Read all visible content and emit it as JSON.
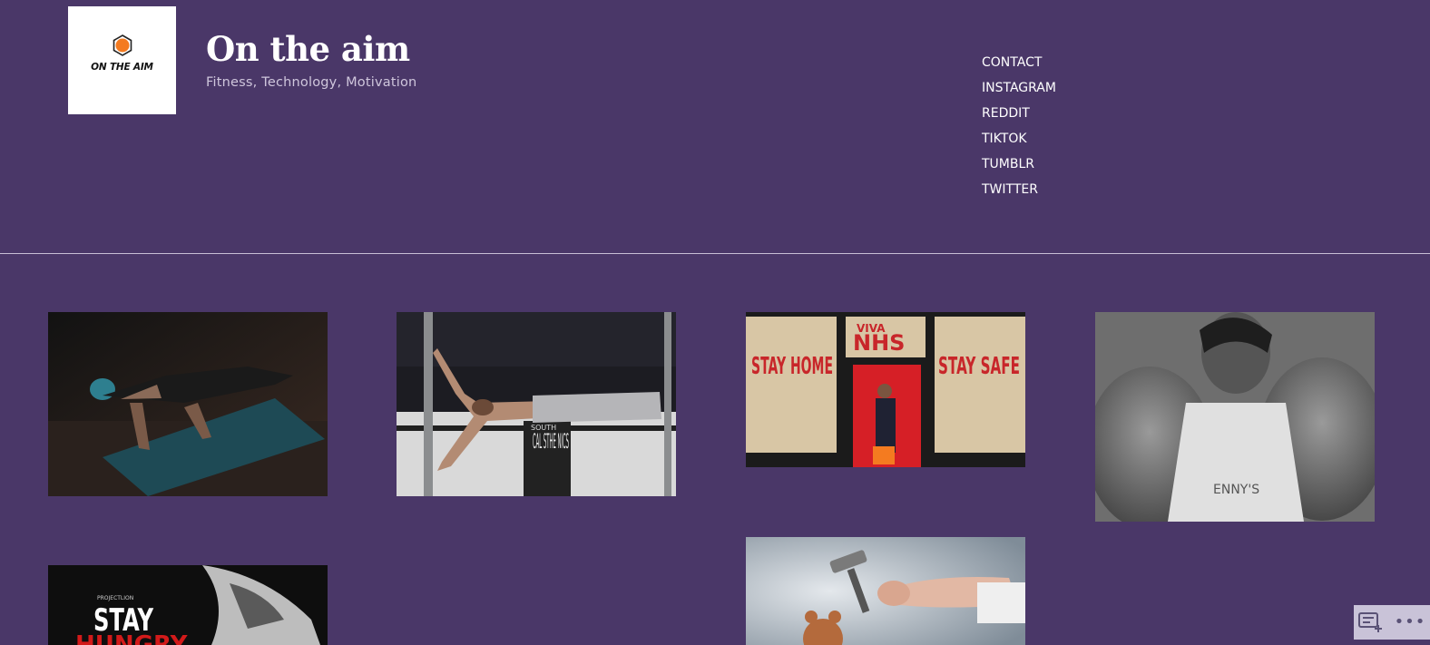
{
  "site": {
    "logo_text": "ON THE AIM",
    "title": "On the aim",
    "tagline": "Fitness, Technology, Motivation"
  },
  "nav": {
    "items": [
      {
        "label": "CONTACT"
      },
      {
        "label": "INSTAGRAM"
      },
      {
        "label": "REDDIT"
      },
      {
        "label": "TIKTOK"
      },
      {
        "label": "TUMBLR"
      },
      {
        "label": "TWITTER"
      }
    ]
  },
  "posts": {
    "calisthenics_sign": "CAL STHE NICS",
    "calisthenics_sign_small": "SOUTH",
    "sign_left": "STAY HOME",
    "sign_center_top": "VIVA",
    "sign_center": "NHS",
    "sign_right": "STAY SAFE",
    "shirt_text": "ENNY'S",
    "poster_small": "PROJECTLION",
    "poster_title": "STAY",
    "poster_sub": "HUNGRY"
  },
  "colors": {
    "background": "#4a3768",
    "text": "#ffffff",
    "tagline": "#cfc6dc",
    "logo_accent": "#f47b20"
  },
  "icons": {
    "logo": "hexagon-dot-icon",
    "new_post": "new-post-icon",
    "more": "more-dots-icon"
  },
  "widget": {
    "more_label": "•••"
  }
}
